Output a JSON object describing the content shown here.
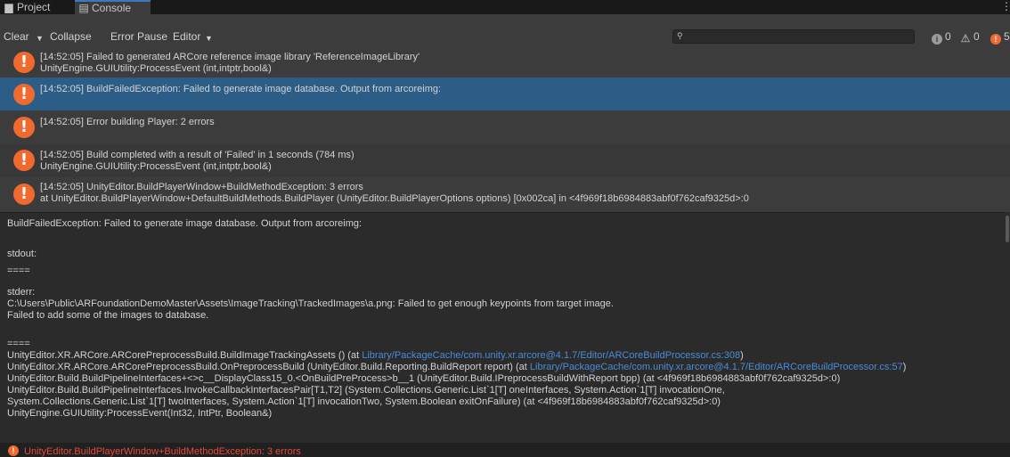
{
  "tabs": {
    "project": {
      "label": "Project",
      "icon": "folder-icon"
    },
    "console": {
      "label": "Console",
      "icon": "console-icon"
    },
    "more_icon": "⋮"
  },
  "toolbar": {
    "clear_label": "Clear",
    "clear_dropdown_arrow": "▼",
    "collapse_label": "Collapse",
    "error_pause_label": "Error Pause",
    "editor_label": "Editor",
    "editor_arrow": "▼",
    "search_placeholder": "",
    "search_icon": "🔍"
  },
  "counters": {
    "info": {
      "icon": "i",
      "count": "0"
    },
    "warning": {
      "icon": "⚠",
      "count": "0"
    },
    "error": {
      "icon": "!",
      "count": "5"
    }
  },
  "log_entries": [
    {
      "line1": "[14:52:05] Failed to generated ARCore reference image library 'ReferenceImageLibrary'",
      "line2": "UnityEngine.GUIUtility:ProcessEvent (int,intptr,bool&)",
      "type": "error",
      "selected": false
    },
    {
      "line1": "[14:52:05] BuildFailedException: Failed to generate image database. Output from arcoreimg:",
      "line2": "",
      "type": "error",
      "selected": true
    },
    {
      "line1": "[14:52:05] Error building Player: 2 errors",
      "line2": "",
      "type": "error",
      "selected": false
    },
    {
      "line1": "[14:52:05] Build completed with a result of 'Failed' in 1 seconds (784 ms)",
      "line2": "UnityEngine.GUIUtility:ProcessEvent (int,intptr,bool&)",
      "type": "error",
      "selected": false
    },
    {
      "line1": "[14:52:05] UnityEditor.BuildPlayerWindow+BuildMethodException: 3 errors",
      "line2": "  at UnityEditor.BuildPlayerWindow+DefaultBuildMethods.BuildPlayer (UnityEditor.BuildPlayerOptions options) [0x002ca] in <4f969f18b6984883abf0f762caf9325d>:0",
      "type": "error",
      "selected": false
    }
  ],
  "detail": {
    "header": "BuildFailedException: Failed to generate image database. Output from arcoreimg:",
    "stdout_label": "stdout:",
    "sep1": "====",
    "stderr_label": "stderr:",
    "stderr_line1": "C:\\Users\\Public\\ARFoundationDemoMaster\\Assets\\ImageTracking\\TrackedImages\\a.png: Failed to get enough keypoints from target image.",
    "stderr_line2": "Failed to add some of the images to database.",
    "sep2": "====",
    "stack1_text": "UnityEditor.XR.ARCore.ARCorePreprocessBuild.BuildImageTrackingAssets () (at ",
    "stack1_link": "Library/PackageCache/com.unity.xr.arcore@4.1.7/Editor/ARCoreBuildProcessor.cs:308",
    "stack1_end": ")",
    "stack2_text": "UnityEditor.XR.ARCore.ARCorePreprocessBuild.OnPreprocessBuild (UnityEditor.Build.Reporting.BuildReport report) (at ",
    "stack2_link": "Library/PackageCache/com.unity.xr.arcore@4.1.7/Editor/ARCoreBuildProcessor.cs:57",
    "stack2_end": ")",
    "stack3": "UnityEditor.Build.BuildPipelineInterfaces+<>c__DisplayClass15_0.<OnBuildPreProcess>b__1 (UnityEditor.Build.IPreprocessBuildWithReport bpp) (at <4f969f18b6984883abf0f762caf9325d>:0)",
    "stack4": "UnityEditor.Build.BuildPipelineInterfaces.InvokeCallbackInterfacesPair[T1,T2] (System.Collections.Generic.List`1[T] oneInterfaces, System.Action`1[T] invocationOne,",
    "stack5": "System.Collections.Generic.List`1[T] twoInterfaces, System.Action`1[T] invocationTwo, System.Boolean exitOnFailure) (at <4f969f18b6984883abf0f762caf9325d>:0)",
    "stack6": "UnityEngine.GUIUtility:ProcessEvent(Int32, IntPtr, Boolean&)"
  },
  "status_bar": {
    "icon": "!",
    "message": "UnityEditor.BuildPlayerWindow+BuildMethodException: 3 errors"
  },
  "colors": {
    "error": "#f06a30",
    "selection": "#2c5d87",
    "link": "#4b8bd8",
    "status_error_text": "#e04a3c"
  }
}
